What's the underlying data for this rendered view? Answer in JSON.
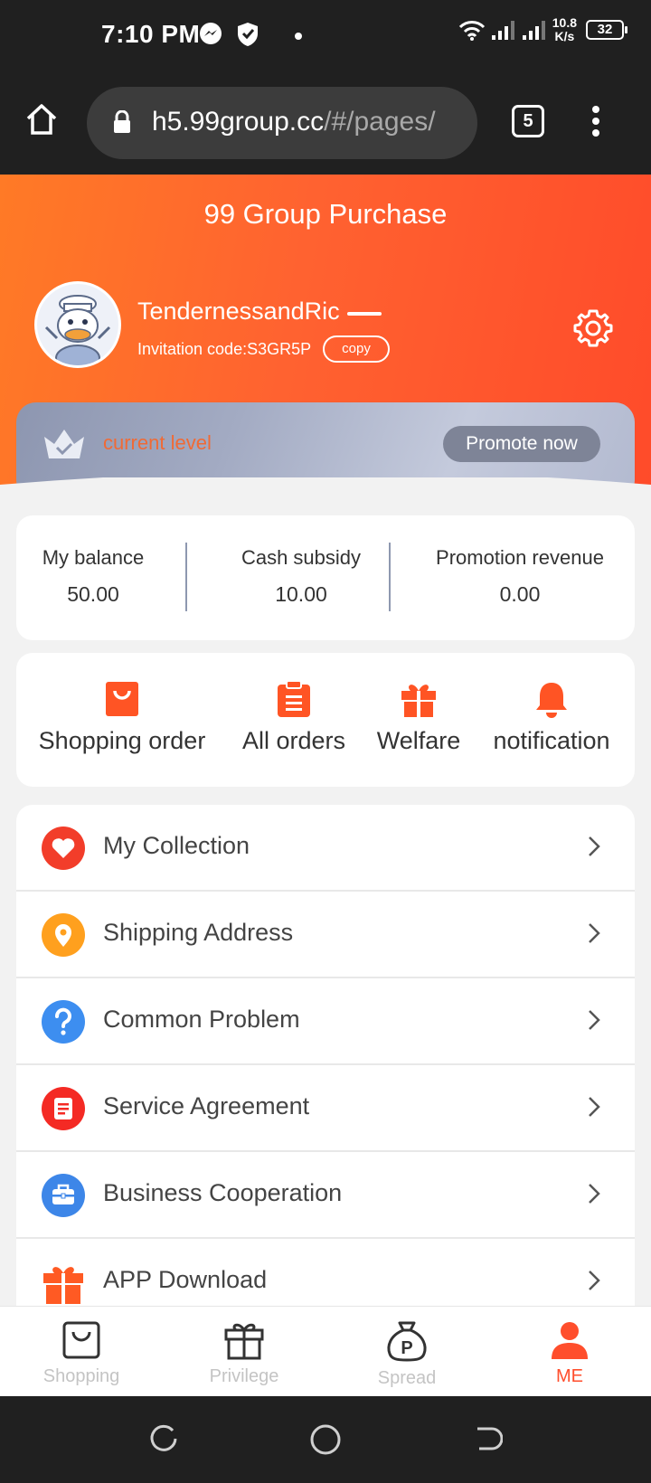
{
  "status_bar": {
    "time": "7:10 PM",
    "network_speed_value": "10.8",
    "network_speed_unit": "K/s",
    "battery": "32"
  },
  "browser": {
    "url_host": "h5.99group.cc",
    "url_path": "/#/pages/",
    "tab_count": "5"
  },
  "header": {
    "title": "99 Group Purchase",
    "username": "TendernessandRic",
    "invitation_code": "Invitation code:S3GR5P",
    "copy_label": "copy"
  },
  "level": {
    "label": "current level",
    "promote_label": "Promote now"
  },
  "balances": [
    {
      "label": "My balance",
      "value": "50.00"
    },
    {
      "label": "Cash subsidy",
      "value": "10.00"
    },
    {
      "label": "Promotion revenue",
      "value": "0.00"
    }
  ],
  "quick_links": [
    {
      "label": "Shopping order",
      "icon": "shopping-bag-icon"
    },
    {
      "label": "All orders",
      "icon": "clipboard-icon"
    },
    {
      "label": "Welfare",
      "icon": "gift-icon"
    },
    {
      "label": "notification",
      "icon": "bell-icon"
    }
  ],
  "menu": [
    {
      "label": "My Collection",
      "icon": "heart-icon",
      "color": "#f23d2a"
    },
    {
      "label": "Shipping Address",
      "icon": "location-pin-icon",
      "color": "#ffa01e"
    },
    {
      "label": "Common Problem",
      "icon": "question-icon",
      "color": "#3d8ef0"
    },
    {
      "label": "Service Agreement",
      "icon": "document-icon",
      "color": "#f42a24"
    },
    {
      "label": "Business Cooperation",
      "icon": "briefcase-icon",
      "color": "#3d86e8"
    },
    {
      "label": "APP Download",
      "icon": "gift-box-icon",
      "color": "#ff5a23"
    }
  ],
  "tabbar": [
    {
      "label": "Shopping",
      "icon": "bag-icon"
    },
    {
      "label": "Privilege",
      "icon": "gift-icon"
    },
    {
      "label": "Spread",
      "icon": "money-bag-icon"
    },
    {
      "label": "ME",
      "icon": "person-icon",
      "active": true
    }
  ],
  "colors": {
    "accent": "#ff4e2c",
    "header_start": "#ff7a26",
    "header_end": "#ff4b2a",
    "inactive_tab": "#c4c4c4"
  }
}
